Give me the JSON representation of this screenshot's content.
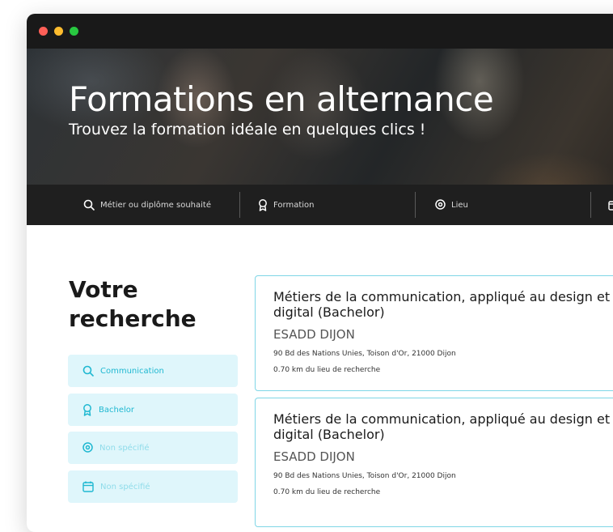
{
  "hero": {
    "title": "Formations en alternance",
    "subtitle": "Trouvez la formation idéale en quelques clics !"
  },
  "searchbar": {
    "items": [
      {
        "label": "Métier ou diplôme souhaité",
        "icon": "search-icon"
      },
      {
        "label": "Formation",
        "icon": "award-icon"
      },
      {
        "label": "Lieu",
        "icon": "location-pin-icon"
      },
      {
        "label": "",
        "icon": "calendar-icon"
      }
    ]
  },
  "sidebar": {
    "title_line1": "Votre",
    "title_line2": "recherche",
    "filters": [
      {
        "label": "Communication",
        "icon": "search-icon"
      },
      {
        "label": "Bachelor",
        "icon": "award-icon"
      },
      {
        "label": "Non spécifié",
        "icon": "location-pin-icon"
      },
      {
        "label": "Non spécifié",
        "icon": "calendar-icon"
      }
    ]
  },
  "results": [
    {
      "title": "Métiers de la communication, appliqué au  design et digital (Bachelor)",
      "school": "ESADD DIJON",
      "address": "90 Bd des Nations Unies, Toison d'Or, 21000 Dijon",
      "distance": "0.70 km du lieu de recherche"
    },
    {
      "title": "Métiers de la communication, appliqué au  design et digital (Bachelor)",
      "school": "ESADD DIJON",
      "address": "90 Bd des Nations Unies, Toison d'Or, 21000 Dijon",
      "distance": "0.70 km du lieu de recherche"
    }
  ],
  "colors": {
    "accent": "#1fb8d1",
    "filter_bg": "#dff6fb",
    "card_border": "#7fd6e6",
    "searchbar_bg": "#1f1f1f",
    "titlebar_bg": "#191919"
  }
}
